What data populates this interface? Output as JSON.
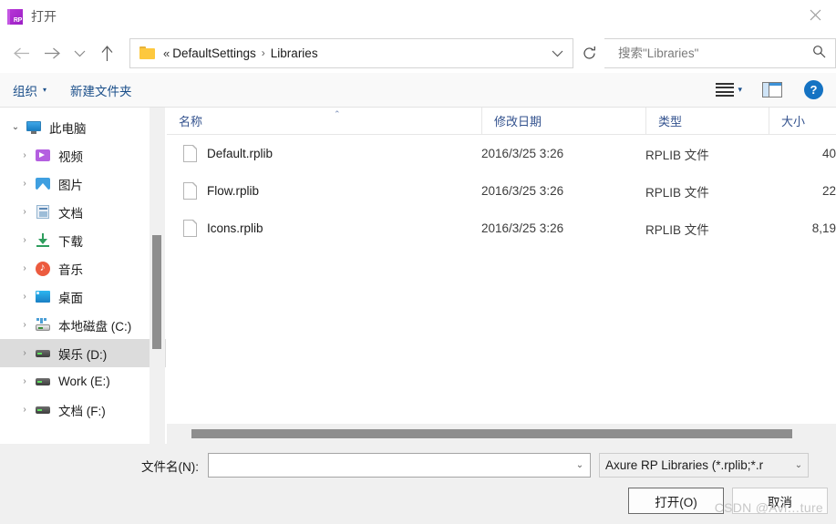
{
  "window": {
    "title": "打开",
    "app_icon": "RP",
    "close_icon": "close-icon"
  },
  "nav": {
    "back": "←",
    "forward": "→",
    "recent": "⌄",
    "up": "↑"
  },
  "address": {
    "folder_icon": "folder-icon",
    "double_chevron": "«",
    "crumbs": [
      "DefaultSettings",
      "Libraries"
    ],
    "separator": "›",
    "dropdown": "⌄",
    "refresh_icon": "refresh-icon"
  },
  "search": {
    "placeholder": "搜索\"Libraries\"",
    "value": "",
    "icon": "search-icon"
  },
  "command_bar": {
    "organize": "组织",
    "organize_caret": "▾",
    "new_folder": "新建文件夹",
    "view_icon": "list-view-icon",
    "view_caret": "▾",
    "preview_pane_icon": "preview-pane-icon",
    "help": "?"
  },
  "sidebar": {
    "items": [
      {
        "label": "此电脑",
        "icon": "monitor-icon",
        "level": 1,
        "expander": "⌄",
        "expanded": true,
        "selected": false
      },
      {
        "label": "视频",
        "icon": "video-icon",
        "level": 2,
        "expander": "›",
        "expanded": false,
        "selected": false
      },
      {
        "label": "图片",
        "icon": "pictures-icon",
        "level": 2,
        "expander": "›",
        "expanded": false,
        "selected": false
      },
      {
        "label": "文档",
        "icon": "documents-icon",
        "level": 2,
        "expander": "›",
        "expanded": false,
        "selected": false
      },
      {
        "label": "下载",
        "icon": "downloads-icon",
        "level": 2,
        "expander": "›",
        "expanded": false,
        "selected": false
      },
      {
        "label": "音乐",
        "icon": "music-icon",
        "level": 2,
        "expander": "›",
        "expanded": false,
        "selected": false
      },
      {
        "label": "桌面",
        "icon": "desktop-icon",
        "level": 2,
        "expander": "›",
        "expanded": false,
        "selected": false
      },
      {
        "label": "本地磁盘 (C:)",
        "icon": "system-drive-icon",
        "level": 2,
        "expander": "›",
        "expanded": false,
        "selected": false
      },
      {
        "label": "娱乐 (D:)",
        "icon": "drive-icon",
        "level": 2,
        "expander": "›",
        "expanded": false,
        "selected": true
      },
      {
        "label": "Work (E:)",
        "icon": "drive-icon",
        "level": 2,
        "expander": "›",
        "expanded": false,
        "selected": false
      },
      {
        "label": "文档 (F:)",
        "icon": "drive-icon",
        "level": 2,
        "expander": "›",
        "expanded": false,
        "selected": false
      }
    ]
  },
  "file_list": {
    "columns": [
      "名称",
      "修改日期",
      "类型",
      "大小"
    ],
    "sort_column": "名称",
    "sort_caret": "⌃",
    "rows": [
      {
        "name": "Default.rplib",
        "date": "2016/3/25 3:26",
        "type": "RPLIB 文件",
        "size": "40"
      },
      {
        "name": "Flow.rplib",
        "date": "2016/3/25 3:26",
        "type": "RPLIB 文件",
        "size": "22"
      },
      {
        "name": "Icons.rplib",
        "date": "2016/3/25 3:26",
        "type": "RPLIB 文件",
        "size": "8,19"
      }
    ]
  },
  "footer": {
    "filename_label": "文件名(N):",
    "filename_value": "",
    "filename_chevron": "⌄",
    "filter_value": "Axure RP Libraries (*.rplib;*.r",
    "filter_chevron": "⌄",
    "open_button": "打开(O)",
    "cancel_button": "取消"
  },
  "watermark": "CSDN @Avi…ture"
}
